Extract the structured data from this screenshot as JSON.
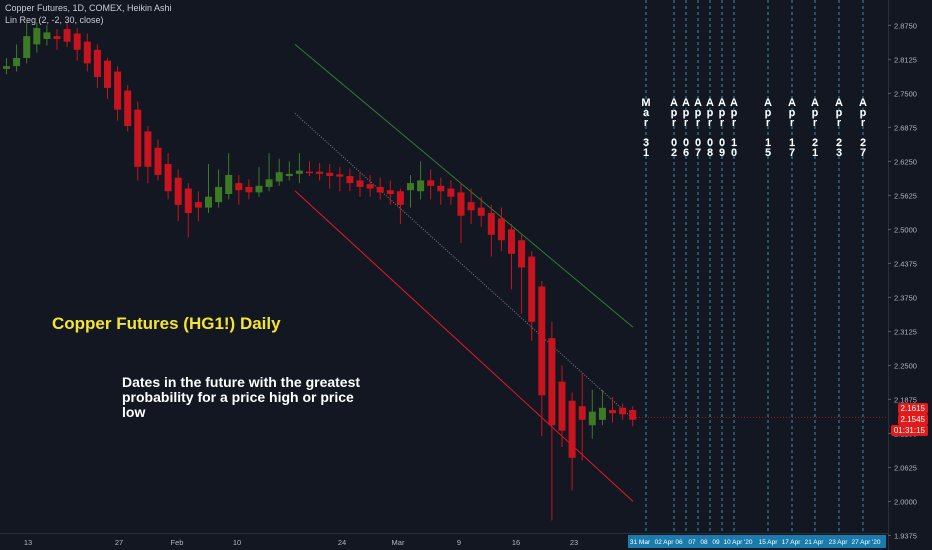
{
  "header": {
    "line1": "Copper Futures, 1D, COMEX, Heikin Ashi",
    "line2": "Lin Reg (2, -2, 30, close)"
  },
  "title": "Copper Futures (HG1!) Daily",
  "note": "Dates in the future with the greatest probability for a price high or price low",
  "vertical_dates": [
    {
      "month": "Mar",
      "day": "31"
    },
    {
      "month": "Apr",
      "day": "02"
    },
    {
      "month": "Apr",
      "day": "06"
    },
    {
      "month": "Apr",
      "day": "07"
    },
    {
      "month": "Apr",
      "day": "08"
    },
    {
      "month": "Apr",
      "day": "09"
    },
    {
      "month": "Apr",
      "day": "10"
    },
    {
      "month": "Apr",
      "day": "15"
    },
    {
      "month": "Apr",
      "day": "17"
    },
    {
      "month": "Apr",
      "day": "21"
    },
    {
      "month": "Apr",
      "day": "23"
    },
    {
      "month": "Apr",
      "day": "27"
    }
  ],
  "bottom_dates": [
    "31 Mar",
    "02 Apr",
    "06",
    "07",
    "08",
    "09",
    "10 Apr '20",
    "15 Apr",
    "17 Apr",
    "21 Apr",
    "23 Apr",
    "27 Apr '20"
  ],
  "price_badges": {
    "upper": "2.1615",
    "lower": "2.1545",
    "timer": "01:31:15"
  },
  "colors": {
    "background": "#131722",
    "up": "#3c7a26",
    "down": "#c8141e",
    "upper_channel": "#2e7d32",
    "lower_channel": "#e5192a",
    "mid_channel": "#9598a1",
    "cycle_lines": "#3aa8c8",
    "date_highlight": "#1c8ec4",
    "title_text": "#f5e52e"
  },
  "chart_data": {
    "type": "candlestick",
    "style": "Heikin Ashi",
    "y_axis": {
      "ticks": [
        "2.8750",
        "2.8125",
        "2.7500",
        "2.6875",
        "2.6250",
        "2.5625",
        "2.5000",
        "2.4375",
        "2.3750",
        "2.3125",
        "2.2500",
        "2.1875",
        "2.1250",
        "2.0625",
        "2.0000",
        "1.9375"
      ],
      "range": [
        1.918,
        2.905
      ]
    },
    "x_axis": {
      "ticks": [
        "13",
        "27",
        "Feb",
        "10",
        "24",
        "Mar",
        "9",
        "16",
        "23"
      ]
    },
    "candles": [
      {
        "o": 2.795,
        "c": 2.8,
        "h": 2.815,
        "l": 2.785
      },
      {
        "o": 2.8,
        "c": 2.815,
        "h": 2.84,
        "l": 2.79
      },
      {
        "o": 2.815,
        "c": 2.855,
        "h": 2.88,
        "l": 2.805
      },
      {
        "o": 2.84,
        "c": 2.87,
        "h": 2.88,
        "l": 2.825
      },
      {
        "o": 2.85,
        "c": 2.862,
        "h": 2.875,
        "l": 2.838
      },
      {
        "o": 2.855,
        "c": 2.85,
        "h": 2.868,
        "l": 2.83
      },
      {
        "o": 2.868,
        "c": 2.845,
        "h": 2.88,
        "l": 2.835
      },
      {
        "o": 2.86,
        "c": 2.83,
        "h": 2.87,
        "l": 2.81
      },
      {
        "o": 2.845,
        "c": 2.805,
        "h": 2.86,
        "l": 2.79
      },
      {
        "o": 2.83,
        "c": 2.78,
        "h": 2.84,
        "l": 2.76
      },
      {
        "o": 2.81,
        "c": 2.76,
        "h": 2.815,
        "l": 2.74
      },
      {
        "o": 2.79,
        "c": 2.72,
        "h": 2.8,
        "l": 2.7
      },
      {
        "o": 2.755,
        "c": 2.69,
        "h": 2.765,
        "l": 2.68
      },
      {
        "o": 2.72,
        "c": 2.615,
        "h": 2.735,
        "l": 2.59
      },
      {
        "o": 2.68,
        "c": 2.615,
        "h": 2.69,
        "l": 2.585
      },
      {
        "o": 2.65,
        "c": 2.6,
        "h": 2.665,
        "l": 2.59
      },
      {
        "o": 2.62,
        "c": 2.57,
        "h": 2.64,
        "l": 2.555
      },
      {
        "o": 2.595,
        "c": 2.545,
        "h": 2.61,
        "l": 2.515
      },
      {
        "o": 2.575,
        "c": 2.53,
        "h": 2.585,
        "l": 2.485
      },
      {
        "o": 2.55,
        "c": 2.54,
        "h": 2.57,
        "l": 2.515
      },
      {
        "o": 2.54,
        "c": 2.56,
        "h": 2.62,
        "l": 2.53
      },
      {
        "o": 2.55,
        "c": 2.578,
        "h": 2.61,
        "l": 2.54
      },
      {
        "o": 2.565,
        "c": 2.6,
        "h": 2.64,
        "l": 2.555
      },
      {
        "o": 2.585,
        "c": 2.572,
        "h": 2.6,
        "l": 2.545
      },
      {
        "o": 2.578,
        "c": 2.568,
        "h": 2.592,
        "l": 2.555
      },
      {
        "o": 2.568,
        "c": 2.58,
        "h": 2.615,
        "l": 2.56
      },
      {
        "o": 2.578,
        "c": 2.592,
        "h": 2.64,
        "l": 2.57
      },
      {
        "o": 2.588,
        "c": 2.605,
        "h": 2.63,
        "l": 2.58
      },
      {
        "o": 2.598,
        "c": 2.602,
        "h": 2.625,
        "l": 2.59
      },
      {
        "o": 2.602,
        "c": 2.608,
        "h": 2.64,
        "l": 2.585
      },
      {
        "o": 2.606,
        "c": 2.605,
        "h": 2.625,
        "l": 2.598
      },
      {
        "o": 2.606,
        "c": 2.602,
        "h": 2.622,
        "l": 2.59
      },
      {
        "o": 2.604,
        "c": 2.598,
        "h": 2.62,
        "l": 2.575
      },
      {
        "o": 2.601,
        "c": 2.597,
        "h": 2.615,
        "l": 2.57
      },
      {
        "o": 2.598,
        "c": 2.585,
        "h": 2.612,
        "l": 2.57
      },
      {
        "o": 2.59,
        "c": 2.578,
        "h": 2.605,
        "l": 2.56
      },
      {
        "o": 2.583,
        "c": 2.575,
        "h": 2.6,
        "l": 2.56
      },
      {
        "o": 2.578,
        "c": 2.568,
        "h": 2.595,
        "l": 2.555
      },
      {
        "o": 2.572,
        "c": 2.565,
        "h": 2.59,
        "l": 2.545
      },
      {
        "o": 2.57,
        "c": 2.545,
        "h": 2.575,
        "l": 2.51
      },
      {
        "o": 2.572,
        "c": 2.585,
        "h": 2.6,
        "l": 2.54
      },
      {
        "o": 2.57,
        "c": 2.59,
        "h": 2.625,
        "l": 2.555
      },
      {
        "o": 2.59,
        "c": 2.58,
        "h": 2.61,
        "l": 2.555
      },
      {
        "o": 2.58,
        "c": 2.57,
        "h": 2.595,
        "l": 2.545
      },
      {
        "o": 2.575,
        "c": 2.56,
        "h": 2.59,
        "l": 2.545
      },
      {
        "o": 2.568,
        "c": 2.525,
        "h": 2.585,
        "l": 2.475
      },
      {
        "o": 2.55,
        "c": 2.535,
        "h": 2.575,
        "l": 2.51
      },
      {
        "o": 2.54,
        "c": 2.525,
        "h": 2.56,
        "l": 2.505
      },
      {
        "o": 2.53,
        "c": 2.49,
        "h": 2.545,
        "l": 2.45
      },
      {
        "o": 2.52,
        "c": 2.48,
        "h": 2.54,
        "l": 2.46
      },
      {
        "o": 2.5,
        "c": 2.455,
        "h": 2.51,
        "l": 2.39
      },
      {
        "o": 2.48,
        "c": 2.43,
        "h": 2.49,
        "l": 2.345
      },
      {
        "o": 2.45,
        "c": 2.33,
        "h": 2.46,
        "l": 2.295
      },
      {
        "o": 2.395,
        "c": 2.195,
        "h": 2.405,
        "l": 2.12
      },
      {
        "o": 2.3,
        "c": 2.14,
        "h": 2.33,
        "l": 1.965
      },
      {
        "o": 2.22,
        "c": 2.13,
        "h": 2.25,
        "l": 2.1
      },
      {
        "o": 2.185,
        "c": 2.08,
        "h": 2.2,
        "l": 2.02
      },
      {
        "o": 2.175,
        "c": 2.15,
        "h": 2.235,
        "l": 2.075
      },
      {
        "o": 2.14,
        "c": 2.165,
        "h": 2.205,
        "l": 2.115
      },
      {
        "o": 2.15,
        "c": 2.172,
        "h": 2.205,
        "l": 2.14
      },
      {
        "o": 2.168,
        "c": 2.162,
        "h": 2.192,
        "l": 2.145
      },
      {
        "o": 2.172,
        "c": 2.16,
        "h": 2.18,
        "l": 2.15
      },
      {
        "o": 2.168,
        "c": 2.15,
        "h": 2.175,
        "l": 2.138
      }
    ],
    "regression_channel": {
      "upper": {
        "start": 2.84,
        "end": 2.32
      },
      "middle": {
        "start": 2.713,
        "end": 2.152
      },
      "lower": {
        "start": 2.571,
        "end": 2.0
      }
    },
    "last_price": "2.1545"
  }
}
